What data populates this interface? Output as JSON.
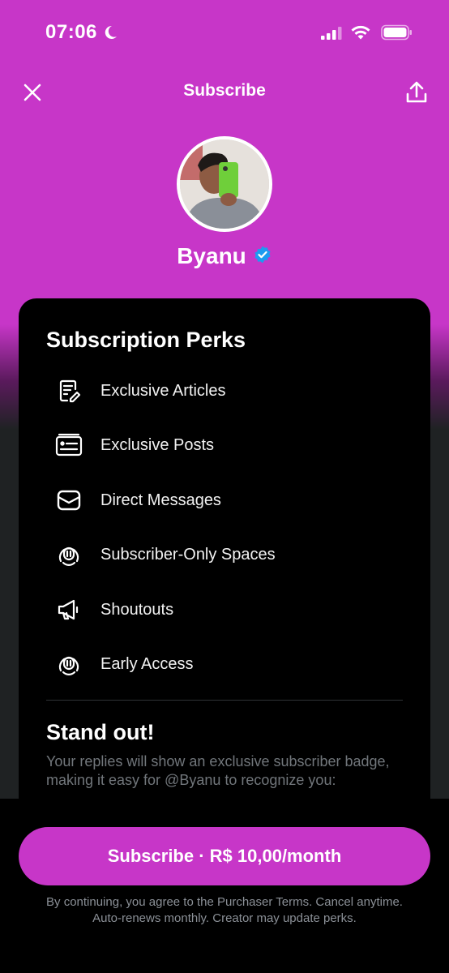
{
  "status_bar": {
    "time": "07:06"
  },
  "header": {
    "title": "Subscribe"
  },
  "profile": {
    "name": "Byanu",
    "verified": true
  },
  "perks": {
    "title": "Subscription Perks",
    "items": [
      {
        "label": "Exclusive Articles",
        "icon": "article-icon"
      },
      {
        "label": "Exclusive Posts",
        "icon": "posts-icon"
      },
      {
        "label": "Direct Messages",
        "icon": "envelope-icon"
      },
      {
        "label": "Subscriber-Only Spaces",
        "icon": "spaces-icon"
      },
      {
        "label": "Shoutouts",
        "icon": "megaphone-icon"
      },
      {
        "label": "Early Access",
        "icon": "spaces-icon"
      }
    ]
  },
  "stand_out": {
    "title": "Stand out!",
    "text": "Your replies will show an exclusive subscriber badge, making it easy for @Byanu to recognize you:"
  },
  "footer": {
    "button_label": "Subscribe · R$ 10,00/month",
    "terms_line1": "By continuing, you agree to the Purchaser Terms. Cancel anytime.",
    "terms_line2": "Auto-renews monthly. Creator may update perks."
  },
  "colors": {
    "accent": "#c736c8",
    "verified": "#1d9bf0",
    "card": "#000000"
  }
}
